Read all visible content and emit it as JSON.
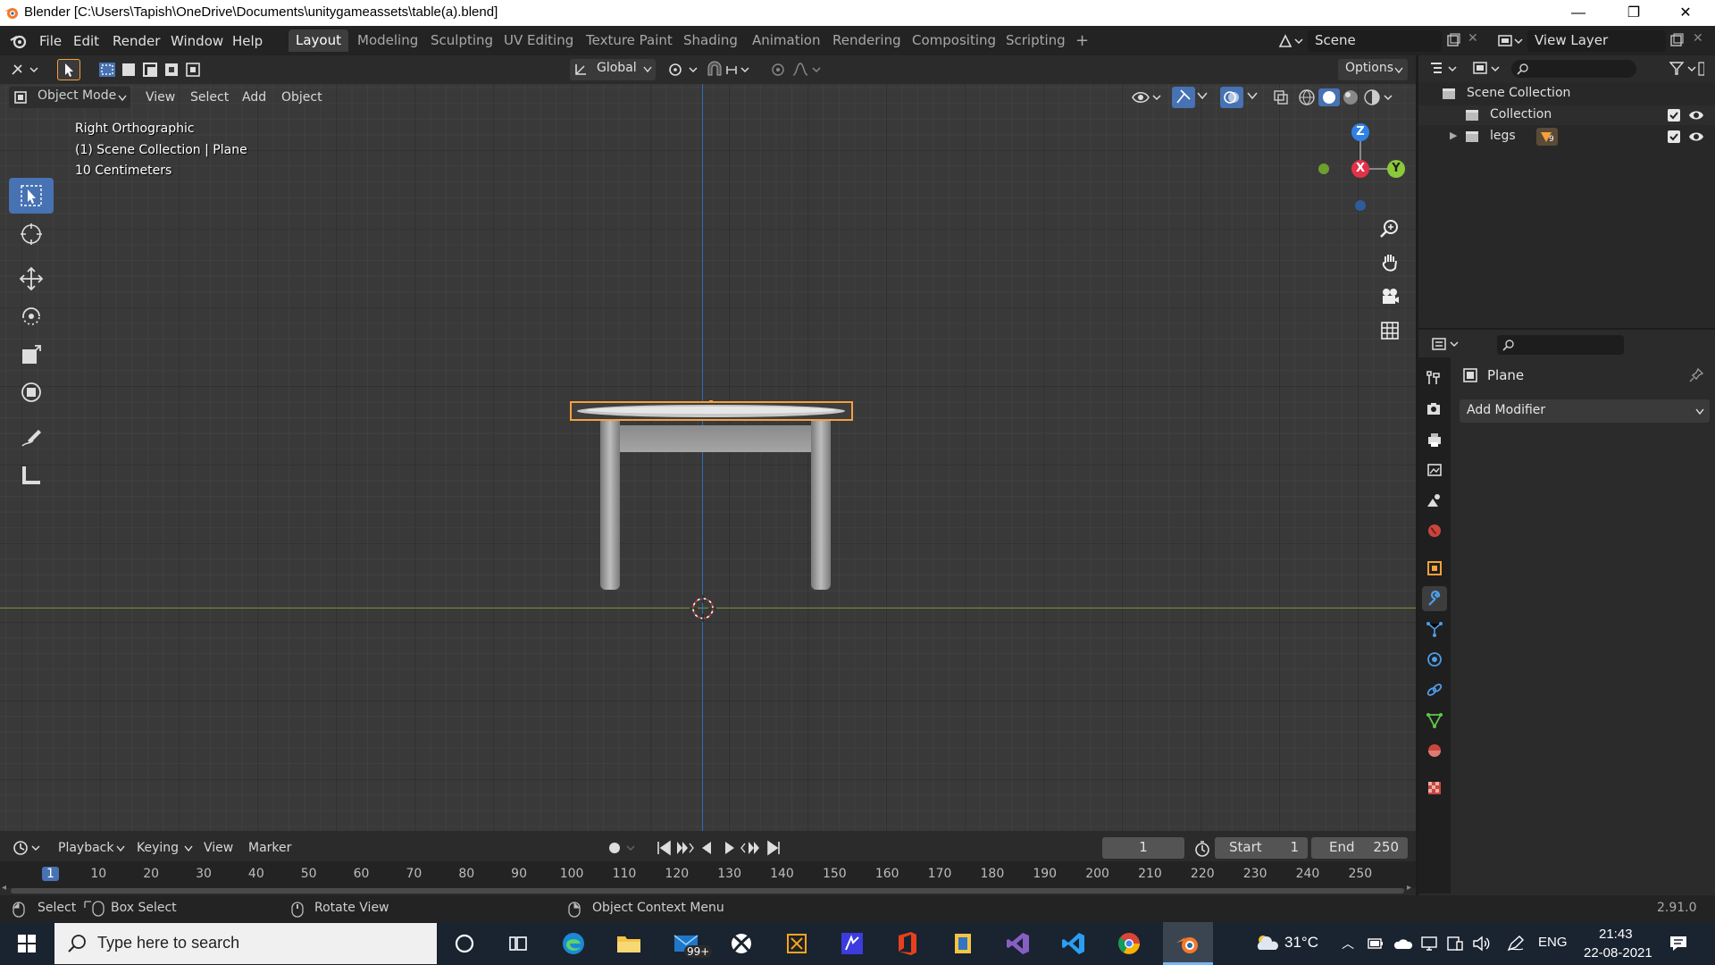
{
  "window": {
    "title": "Blender [C:\\Users\\Tapish\\OneDrive\\Documents\\unitygameassets\\table(a).blend]",
    "minimize": "—",
    "restore": "❐",
    "close": "✕"
  },
  "menu": {
    "file": "File",
    "edit": "Edit",
    "render": "Render",
    "window": "Window",
    "help": "Help"
  },
  "workspaces": [
    "Layout",
    "Modeling",
    "Sculpting",
    "UV Editing",
    "Texture Paint",
    "Shading",
    "Animation",
    "Rendering",
    "Compositing",
    "Scripting"
  ],
  "add_workspace": "+",
  "scene": {
    "name": "Scene",
    "view_layer": "View Layer"
  },
  "toolbar": {
    "transform_orientation": "Global",
    "options": "Options"
  },
  "viewport_header": {
    "mode": "Object Mode",
    "view": "View",
    "select": "Select",
    "add": "Add",
    "object": "Object"
  },
  "viewport_overlay": {
    "view_name": "Right Orthographic",
    "collection_info": "(1) Scene Collection | Plane",
    "grid_scale": "10 Centimeters"
  },
  "gizmo": {
    "z": "Z",
    "x": "X",
    "y": "Y"
  },
  "outliner": {
    "root": "Scene Collection",
    "items": [
      {
        "label": "Collection"
      },
      {
        "label": "legs",
        "badge": "9"
      }
    ]
  },
  "properties": {
    "object_name": "Plane",
    "add_modifier": "Add Modifier"
  },
  "timeline": {
    "playback": "Playback",
    "keying": "Keying",
    "view": "View",
    "marker": "Marker",
    "current_frame": "1",
    "start_label": "Start",
    "start_value": "1",
    "end_label": "End",
    "end_value": "250",
    "ruler": [
      "1",
      "10",
      "20",
      "30",
      "40",
      "50",
      "60",
      "70",
      "80",
      "90",
      "100",
      "110",
      "120",
      "130",
      "140",
      "150",
      "160",
      "170",
      "180",
      "190",
      "200",
      "210",
      "220",
      "230",
      "240",
      "250"
    ]
  },
  "statusbar": {
    "select": "Select",
    "box_select": "Box Select",
    "rotate_view": "Rotate View",
    "context_menu": "Object Context Menu",
    "version": "2.91.0"
  },
  "taskbar": {
    "search_placeholder": "Type here to search",
    "mail_badge": "99+",
    "temperature": "31°C",
    "language": "ENG",
    "time": "21:43",
    "date": "22-08-2021"
  },
  "colors": {
    "selection_outline": "#f5a13b",
    "active_tool": "#4772b3",
    "x_axis": "#e2324a",
    "y_axis": "#8bc83a",
    "z_axis": "#2f82e5",
    "taskbar": "#1a2330"
  }
}
